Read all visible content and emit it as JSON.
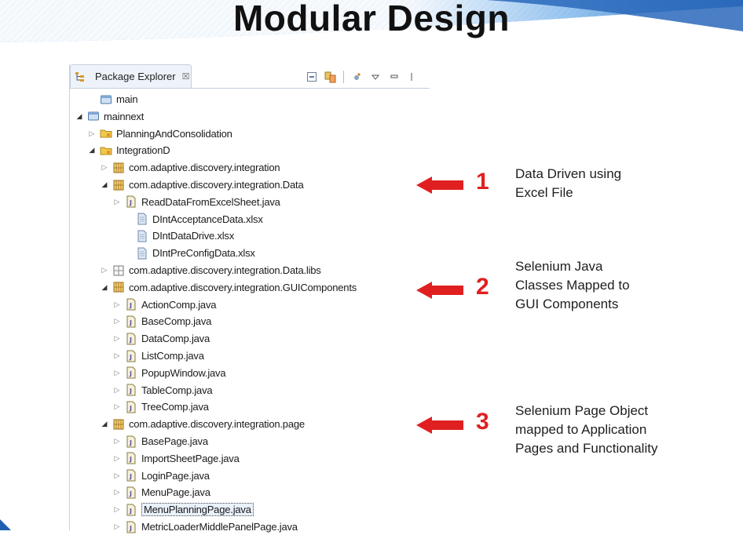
{
  "slide": {
    "title": "Modular Design"
  },
  "explorer": {
    "tab_label": "Package Explorer",
    "tab_close": "☒"
  },
  "tree": [
    {
      "label": "main",
      "icon": "project-icon",
      "twisty": "none"
    },
    {
      "label": "mainnext",
      "icon": "project-icon",
      "twisty": "open"
    },
    {
      "label": "PlanningAndConsolidation",
      "icon": "folder-icon",
      "twisty": "closed"
    },
    {
      "label": "IntegrationD",
      "icon": "folder-icon",
      "twisty": "open"
    },
    {
      "label": "com.adaptive.discovery.integration",
      "icon": "package-icon",
      "twisty": "closed"
    },
    {
      "label": "com.adaptive.discovery.integration.Data",
      "icon": "package-icon",
      "twisty": "open"
    },
    {
      "label": "ReadDataFromExcelSheet.java",
      "icon": "java-file-icon",
      "twisty": "closed"
    },
    {
      "label": "DIntAcceptanceData.xlsx",
      "icon": "file-icon",
      "twisty": "none"
    },
    {
      "label": "DIntDataDrive.xlsx",
      "icon": "file-icon",
      "twisty": "none"
    },
    {
      "label": "DIntPreConfigData.xlsx",
      "icon": "file-icon",
      "twisty": "none"
    },
    {
      "label": "com.adaptive.discovery.integration.Data.libs",
      "icon": "library-icon",
      "twisty": "closed"
    },
    {
      "label": "com.adaptive.discovery.integration.GUIComponents",
      "icon": "package-icon",
      "twisty": "open"
    },
    {
      "label": "ActionComp.java",
      "icon": "java-file-icon",
      "twisty": "closed"
    },
    {
      "label": "BaseComp.java",
      "icon": "java-file-icon",
      "twisty": "closed"
    },
    {
      "label": "DataComp.java",
      "icon": "java-file-icon",
      "twisty": "closed"
    },
    {
      "label": "ListComp.java",
      "icon": "java-file-icon",
      "twisty": "closed"
    },
    {
      "label": "PopupWindow.java",
      "icon": "java-file-icon",
      "twisty": "closed"
    },
    {
      "label": "TableComp.java",
      "icon": "java-file-icon",
      "twisty": "closed"
    },
    {
      "label": "TreeComp.java",
      "icon": "java-file-icon",
      "twisty": "closed"
    },
    {
      "label": "com.adaptive.discovery.integration.page",
      "icon": "package-icon",
      "twisty": "open"
    },
    {
      "label": "BasePage.java",
      "icon": "java-file-icon",
      "twisty": "closed"
    },
    {
      "label": "ImportSheetPage.java",
      "icon": "java-file-icon",
      "twisty": "closed"
    },
    {
      "label": "LoginPage.java",
      "icon": "java-file-icon",
      "twisty": "closed"
    },
    {
      "label": "MenuPage.java",
      "icon": "java-file-icon",
      "twisty": "closed"
    },
    {
      "label": "MenuPlanningPage.java",
      "icon": "java-file-icon",
      "twisty": "closed",
      "selected": true
    },
    {
      "label": "MetricLoaderMiddlePanelPage.java",
      "icon": "java-file-icon",
      "twisty": "closed"
    }
  ],
  "annotations": [
    {
      "number": "1",
      "lines": [
        "Data Driven using",
        "Excel File"
      ]
    },
    {
      "number": "2",
      "lines": [
        "Selenium Java",
        "Classes Mapped to",
        "GUI Components"
      ]
    },
    {
      "number": "3",
      "lines": [
        "Selenium Page Object",
        "mapped to Application",
        "Pages and Functionality"
      ]
    }
  ],
  "colors": {
    "arrow": "#e02020",
    "banner": "#1f5fb0"
  }
}
